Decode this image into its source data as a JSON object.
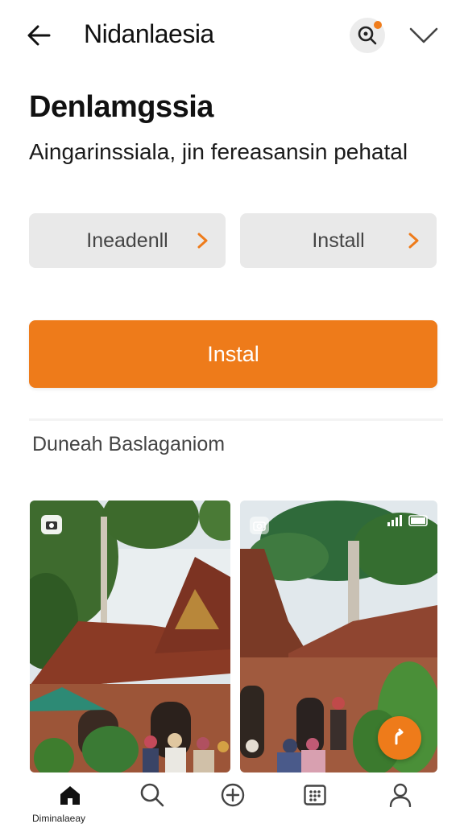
{
  "topbar": {
    "title": "Nidanlaesia",
    "back_icon": "arrow-left-icon",
    "search_icon": "search-icon",
    "chevron_icon": "chevron-down-icon",
    "notification_dot_color": "#f07d1c"
  },
  "main": {
    "heading": "Denlamgssia",
    "subtitle": "Aingarinssiala, jin fereasansin pehatal",
    "buttons": [
      {
        "label": "Ineadenll",
        "icon": "chevron-right-icon"
      },
      {
        "label": "Install",
        "icon": "chevron-right-icon"
      }
    ],
    "install_button": {
      "label": "Instal",
      "color": "#ee7b1a"
    },
    "section_label": "Duneah Baslaganiom"
  },
  "gallery": {
    "images": [
      {
        "subject": "traditional-building-photo",
        "badge_icon": "camera-icon"
      },
      {
        "subject": "traditional-building-photo",
        "badge_icon": "camera-icon",
        "action_icon": "edit-icon"
      }
    ]
  },
  "bottom_nav": {
    "items": [
      {
        "icon": "home-icon"
      },
      {
        "icon": "search-icon"
      },
      {
        "icon": "add-circle-icon"
      },
      {
        "icon": "grid-icon"
      },
      {
        "icon": "profile-icon"
      }
    ],
    "active_label": "Diminalaeay"
  }
}
